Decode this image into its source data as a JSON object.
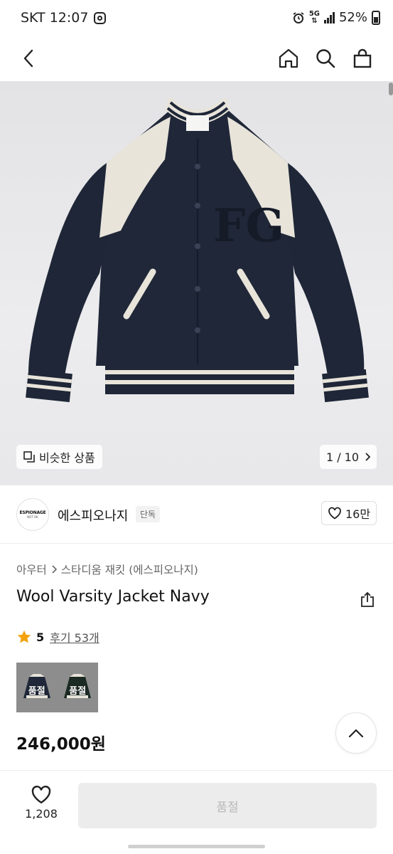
{
  "status_bar": {
    "carrier_time": "SKT 12:07",
    "network": "5G",
    "battery": "52%"
  },
  "hero": {
    "similar_label": "비슷한 상품",
    "counter": "1 / 10"
  },
  "brand": {
    "logo_line1": "ESPIONAGE",
    "logo_line2": "NOT OK",
    "name": "에스피오나지",
    "tag": "단독",
    "likes": "16만"
  },
  "breadcrumb": {
    "category": "아우터",
    "subcategory": "스타디움 재킷 (에스피오나지)"
  },
  "product": {
    "title": "Wool Varsity Jacket Navy",
    "rating": "5",
    "reviews": "후기 53개",
    "price": "246,000원",
    "variants": [
      {
        "label": "품절"
      },
      {
        "label": "품절"
      }
    ]
  },
  "bottom": {
    "wish_count": "1,208",
    "buy_label": "품절"
  },
  "colors": {
    "jacket_navy": "#1f2738",
    "leather_cream": "#e8e4da",
    "star": "#f2a20c"
  }
}
